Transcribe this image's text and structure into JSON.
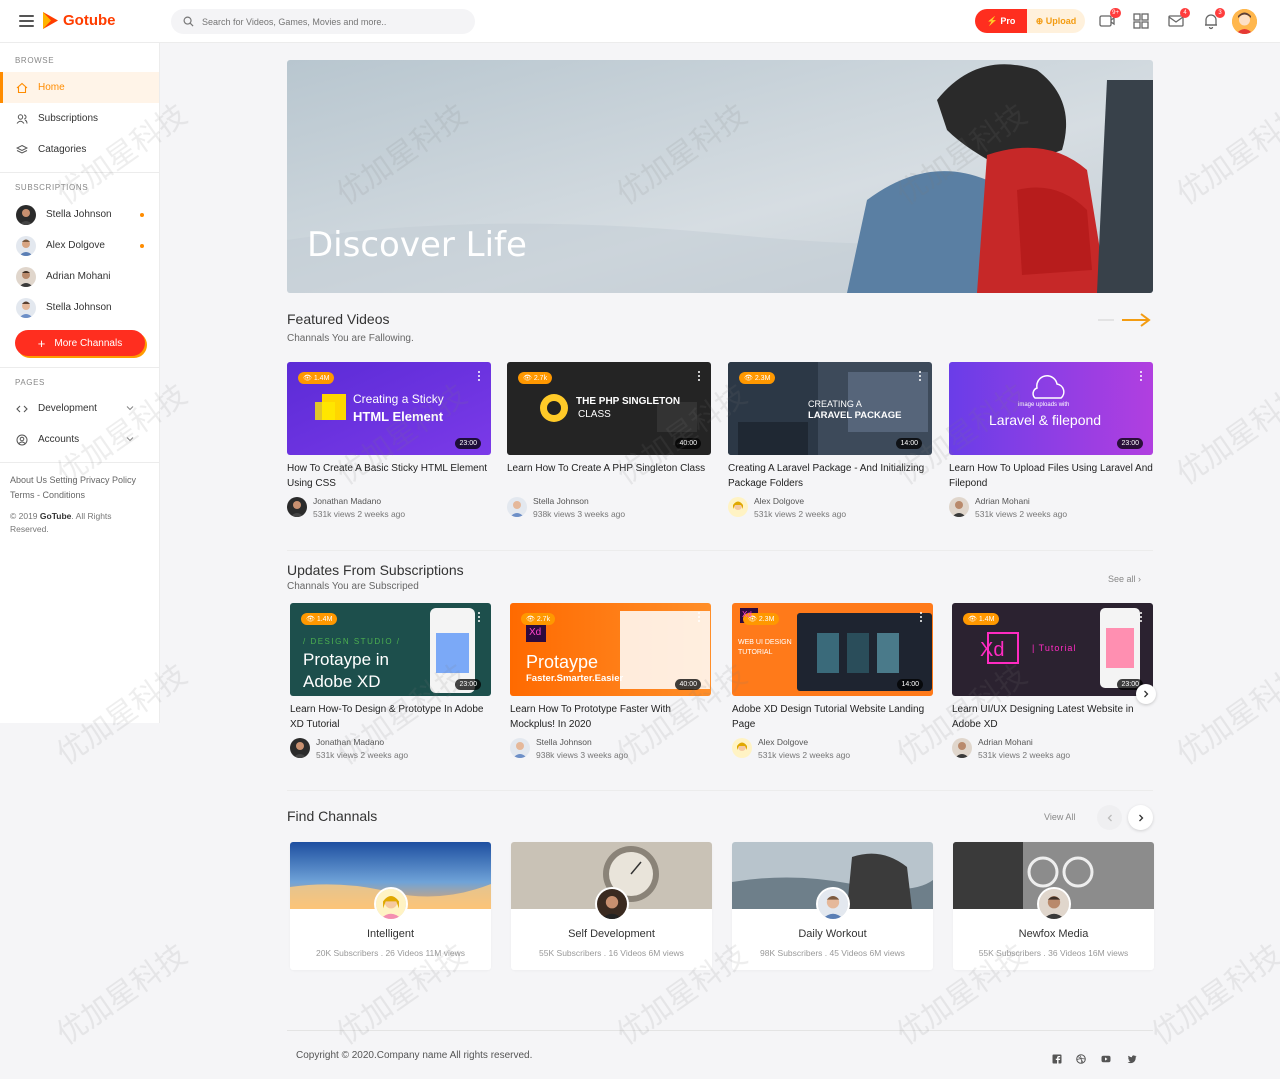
{
  "header": {
    "brand": "Gotube",
    "search_placeholder": "Search for Videos, Games, Movies and more..",
    "pro_label": "Pro",
    "upload_label": "Upload",
    "badges": {
      "video": "9+",
      "mail": "4",
      "bell": "3"
    }
  },
  "sidebar": {
    "browse_title": "BROWSE",
    "browse": [
      {
        "label": "Home",
        "icon": "home-icon",
        "active": true
      },
      {
        "label": "Subscriptions",
        "icon": "users-icon"
      },
      {
        "label": "Catagories",
        "icon": "layers-icon"
      }
    ],
    "subs_title": "SUBSCRIPTIONS",
    "subscriptions": [
      {
        "label": "Stella Johnson",
        "dot": true
      },
      {
        "label": "Alex Dolgove",
        "dot": true
      },
      {
        "label": "Adrian Mohani",
        "dot": false
      },
      {
        "label": "Stella Johnson",
        "dot": false
      }
    ],
    "more_label": "More Channals",
    "pages_title": "PAGES",
    "pages": [
      {
        "label": "Development",
        "icon": "code-icon"
      },
      {
        "label": "Accounts",
        "icon": "user-circle-icon"
      }
    ],
    "links": "About Us  Setting  Privacy Policy  Terms - Conditions",
    "copyright_prefix": "© 2019 ",
    "copyright_brand": "GoTube",
    "copyright_suffix": ". All Rights Reserved."
  },
  "hero": {
    "text": "Discover Life"
  },
  "featured": {
    "title": "Featured Videos",
    "subtitle": "Channals You are Fallowing.",
    "videos": [
      {
        "views": "1.4M",
        "duration": "23:00",
        "thumb_line1": "Creating a Sticky",
        "thumb_line2": "HTML Element",
        "title": "How To Create A Basic Sticky HTML Element Using CSS",
        "channel": "Jonathan Madano",
        "meta": "531k views 2 weeks ago"
      },
      {
        "views": "2.7k",
        "duration": "40:00",
        "thumb_line1": "THE PHP SINGLETON",
        "thumb_line2": "CLASS",
        "title": "Learn How To Create A PHP Singleton Class",
        "channel": "Stella Johnson",
        "meta": "938k views 3 weeks ago"
      },
      {
        "views": "2.3M",
        "duration": "14:00",
        "thumb_line1": "CREATING A",
        "thumb_line2": "LARAVEL PACKAGE",
        "title": "Creating A Laravel Package - And Initializing Package Folders",
        "channel": "Alex Dolgove",
        "meta": "531k views 2 weeks ago"
      },
      {
        "views": "",
        "duration": "23:00",
        "thumb_line1": "image uploads with",
        "thumb_line2": "Laravel & filepond",
        "title": "Learn How To Upload Files Using Laravel And Filepond",
        "channel": "Adrian Mohani",
        "meta": "531k views 2 weeks ago"
      }
    ]
  },
  "updates": {
    "title": "Updates From Subscriptions",
    "subtitle": "Channals You are Subscriped",
    "see_all": "See all",
    "videos": [
      {
        "views": "1.4M",
        "duration": "23:00",
        "thumb_line0": "/ DESIGN STUDIO /",
        "thumb_line1": "Protaype in",
        "thumb_line2": "Adobe XD",
        "title": "Learn How-To Design & Prototype In Adobe XD Tutorial",
        "channel": "Jonathan Madano",
        "meta": "531k views 2 weeks ago"
      },
      {
        "views": "2.7k",
        "duration": "40:00",
        "thumb_line0": "Xd",
        "thumb_line1": "Protaype",
        "thumb_line2": "Faster.Smarter.Easier",
        "title": "Learn How To Prototype Faster With Mockplus! In 2020",
        "channel": "Stella Johnson",
        "meta": "938k views 3 weeks ago"
      },
      {
        "views": "2.3M",
        "duration": "14:00",
        "thumb_line0": "Xd",
        "thumb_line1": "WEB UI DESIGN",
        "thumb_line2": "TUTORIAL",
        "title": "Adobe XD Design Tutorial Website Landing Page",
        "channel": "Alex Dolgove",
        "meta": "531k views 2 weeks ago"
      },
      {
        "views": "1.4M",
        "duration": "23:00",
        "thumb_line0": "Xd",
        "thumb_line1": "| Tutorial",
        "thumb_line2": "",
        "title": "Learn UI/UX Designing Latest Website in Adobe XD",
        "channel": "Adrian Mohani",
        "meta": "531k views 2 weeks ago"
      }
    ]
  },
  "channels": {
    "title": "Find Channals",
    "view_all": "View All",
    "items": [
      {
        "name": "Intelligent",
        "stats": "20K Subscribers . 26 Videos 11M views"
      },
      {
        "name": "Self Development",
        "stats": "55K Subscribers . 16 Videos 6M views"
      },
      {
        "name": "Daily Workout",
        "stats": "98K Subscribers . 45 Videos 6M views"
      },
      {
        "name": "Newfox Media",
        "stats": "55K Subscribers . 36 Videos 16M views"
      }
    ]
  },
  "footer": {
    "copyright": "Copyright © 2020.Company name All rights reserved."
  },
  "watermark": "优加星科技",
  "colors": {
    "accent": "#ff8c00",
    "brand_red": "#ff2e1f"
  }
}
